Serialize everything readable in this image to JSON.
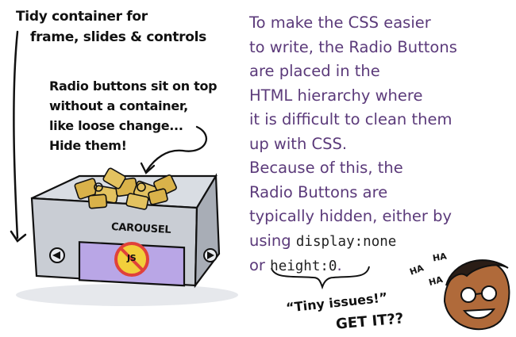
{
  "notes": {
    "container": [
      "Tidy container for",
      "frame, slides & controls"
    ],
    "radio": [
      "Radio buttons sit on top",
      "without a container,",
      "like loose change...",
      "Hide them!"
    ]
  },
  "box_label": "CAROUSEL",
  "js_badge": "JS",
  "explanation": {
    "lines": [
      "To make the CSS easier",
      "to write, the Radio Buttons",
      "are placed in the",
      "HTML hierarchy where",
      "it is difficult to clean them",
      "up with CSS.",
      "Because of this, the",
      "Radio Buttons are",
      "typically hidden, either by"
    ],
    "using_prefix": "using ",
    "code_display": "display:none",
    "or_prefix": "or ",
    "code_height": "height:0",
    "period": "."
  },
  "joke": {
    "tiny": "“Tiny issues!”",
    "getit": "GET IT??"
  },
  "laugh": [
    "HA",
    "HA",
    "HA"
  ],
  "colors": {
    "text_purple": "#5b3a7a",
    "box_gray": "#c9cdd4",
    "screen_purple": "#b9a6e6",
    "gold": "#d9b24a",
    "forbidden_red": "#e0413a",
    "badge_yellow": "#f2cf3b"
  },
  "icons": [
    "arrow-left-icon",
    "arrow-right-icon",
    "no-js-icon",
    "laughing-face-icon"
  ]
}
